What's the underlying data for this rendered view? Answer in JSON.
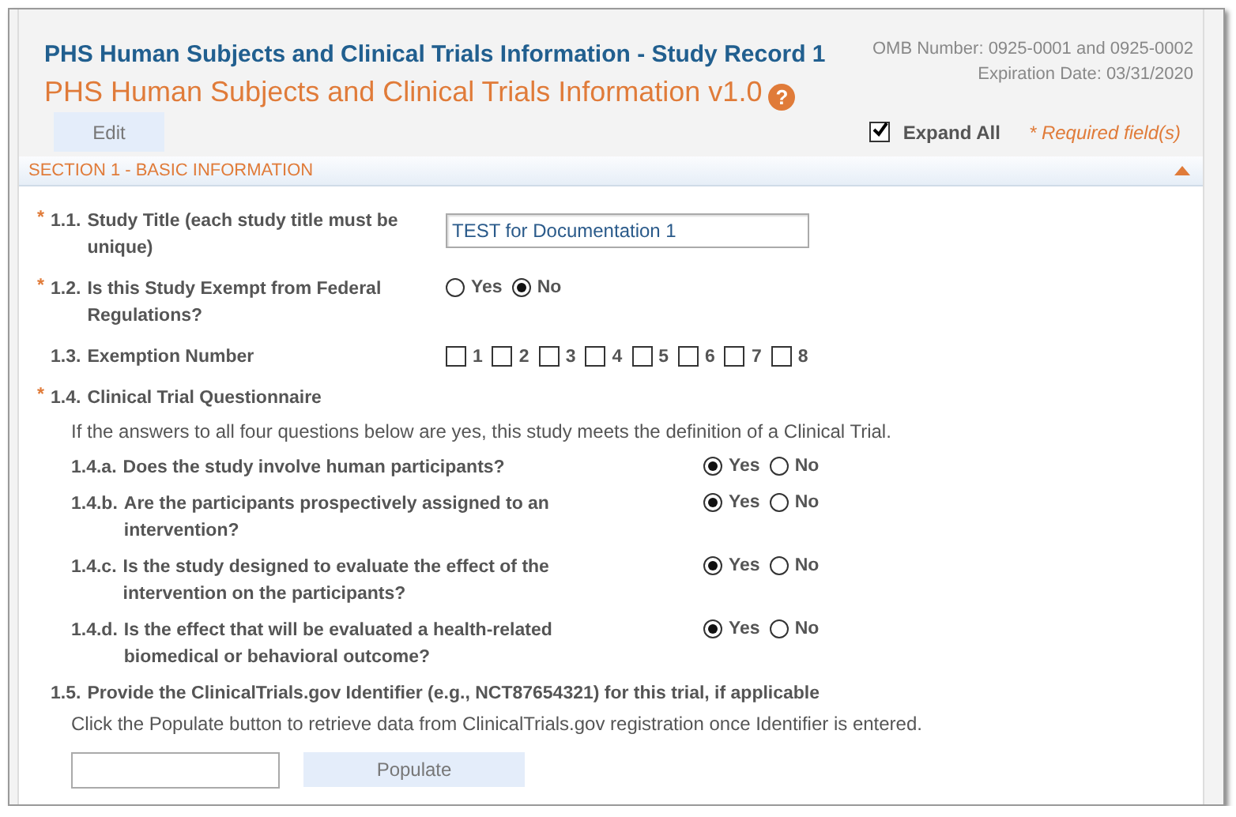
{
  "header": {
    "title": "PHS Human Subjects and Clinical Trials Information - Study Record 1",
    "subtitle": "PHS Human Subjects and Clinical Trials Information v1.0",
    "help_icon": "?",
    "omb_number": "OMB Number: 0925-0001 and 0925-0002",
    "expiration": "Expiration Date: 03/31/2020",
    "edit_button": "Edit",
    "expand_all": {
      "label": "Expand All",
      "checked": true
    },
    "required_note": "* Required field(s)"
  },
  "section": {
    "title": "SECTION 1 - BASIC INFORMATION",
    "expanded": true,
    "fields": [
      {
        "kind": "text",
        "required_mark": "*",
        "number": "1.1.",
        "label": "Study Title (each study title must be unique)",
        "value": "TEST for Documentation 1"
      },
      {
        "kind": "radio",
        "required_mark": "*",
        "number": "1.2.",
        "label": "Is this Study Exempt from Federal Regulations?",
        "options": [
          {
            "label": "Yes",
            "selected": false
          },
          {
            "label": "No",
            "selected": true
          }
        ]
      },
      {
        "kind": "checkboxes",
        "number": "1.3.",
        "label": "Exemption Number",
        "options": [
          {
            "label": "1",
            "checked": false
          },
          {
            "label": "2",
            "checked": false
          },
          {
            "label": "3",
            "checked": false
          },
          {
            "label": "4",
            "checked": false
          },
          {
            "label": "5",
            "checked": false
          },
          {
            "label": "6",
            "checked": false
          },
          {
            "label": "7",
            "checked": false
          },
          {
            "label": "8",
            "checked": false
          }
        ]
      },
      {
        "kind": "group",
        "required_mark": "*",
        "number": "1.4.",
        "label": "Clinical Trial Questionnaire",
        "note": "If the answers to all four questions below are yes, this study meets the definition of a Clinical Trial.",
        "questions": [
          {
            "number": "1.4.a.",
            "label": "Does the study involve human participants?",
            "options": [
              {
                "label": "Yes",
                "selected": true
              },
              {
                "label": "No",
                "selected": false
              }
            ]
          },
          {
            "number": "1.4.b.",
            "label": "Are the participants prospectively assigned to an intervention?",
            "options": [
              {
                "label": "Yes",
                "selected": true
              },
              {
                "label": "No",
                "selected": false
              }
            ]
          },
          {
            "number": "1.4.c.",
            "label": "Is the study designed to evaluate the effect of the intervention on the participants?",
            "options": [
              {
                "label": "Yes",
                "selected": true
              },
              {
                "label": "No",
                "selected": false
              }
            ]
          },
          {
            "number": "1.4.d.",
            "label": "Is the effect that will be evaluated a health-related biomedical or behavioral outcome?",
            "options": [
              {
                "label": "Yes",
                "selected": true
              },
              {
                "label": "No",
                "selected": false
              }
            ]
          }
        ]
      },
      {
        "kind": "identifier",
        "number": "1.5.",
        "label": "Provide the ClinicalTrials.gov Identifier (e.g., NCT87654321) for this trial, if applicable",
        "note": "Click the Populate button to retrieve data from ClinicalTrials.gov registration once Identifier is entered.",
        "button": "Populate"
      }
    ]
  }
}
